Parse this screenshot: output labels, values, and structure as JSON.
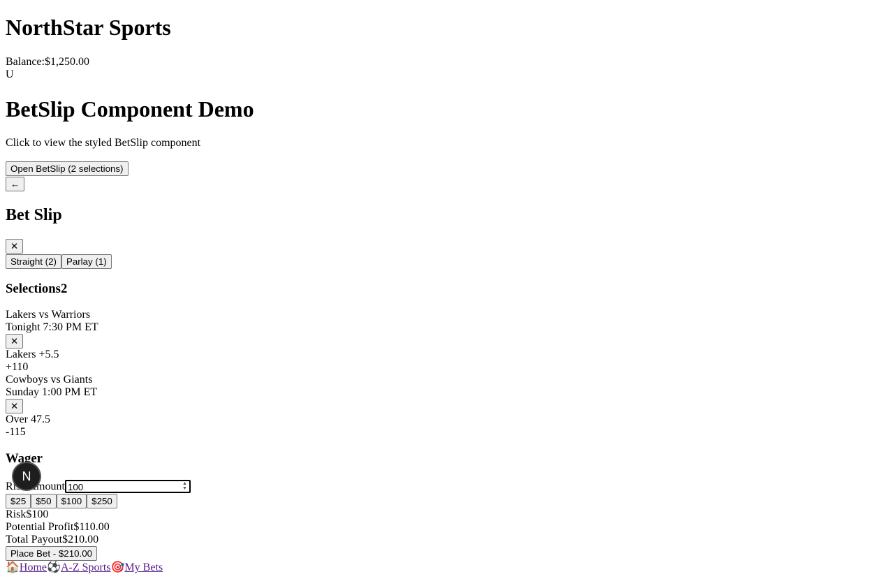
{
  "header": {
    "brand": "NorthStar Sports",
    "balance_label": "Balance:",
    "balance_value": "$1,250.00",
    "user_initial": "U"
  },
  "demo": {
    "title": "BetSlip Component Demo",
    "subtitle": "Click to view the styled BetSlip component",
    "open_button": "Open BetSlip (2 selections)",
    "back_button": "←"
  },
  "betslip": {
    "title": "Bet Slip",
    "close_label": "✕",
    "tabs": [
      "Straight (2)",
      "Parlay (1)"
    ],
    "selections_label": "Selections",
    "selections_count": "2",
    "selections": [
      {
        "match": "Lakers vs Warriors",
        "time": "Tonight 7:30 PM ET",
        "remove": "✕",
        "pick": "Lakers +5.5",
        "odds": "+110"
      },
      {
        "match": "Cowboys vs Giants",
        "time": "Sunday 1:00 PM ET",
        "remove": "✕",
        "pick": "Over 47.5",
        "odds": "-115"
      }
    ],
    "wager": {
      "title": "Wager",
      "risk_amount_label": "Risk Amount",
      "risk_amount_value": "100",
      "quick_amounts": [
        "$25",
        "$50",
        "$100",
        "$250"
      ],
      "risk_label": "Risk",
      "risk_value": "$100",
      "profit_label": "Potential Profit",
      "profit_value": "$110.00",
      "payout_label": "Total Payout",
      "payout_value": "$210.00"
    },
    "place_bet": "Place Bet - $210.00"
  },
  "bottom_nav": [
    {
      "icon": "🏠",
      "label": "Home"
    },
    {
      "icon": "⚽",
      "label": "A-Z Sports"
    },
    {
      "icon": "🎯",
      "label": "My Bets"
    }
  ],
  "fab": {
    "letter": "N"
  }
}
